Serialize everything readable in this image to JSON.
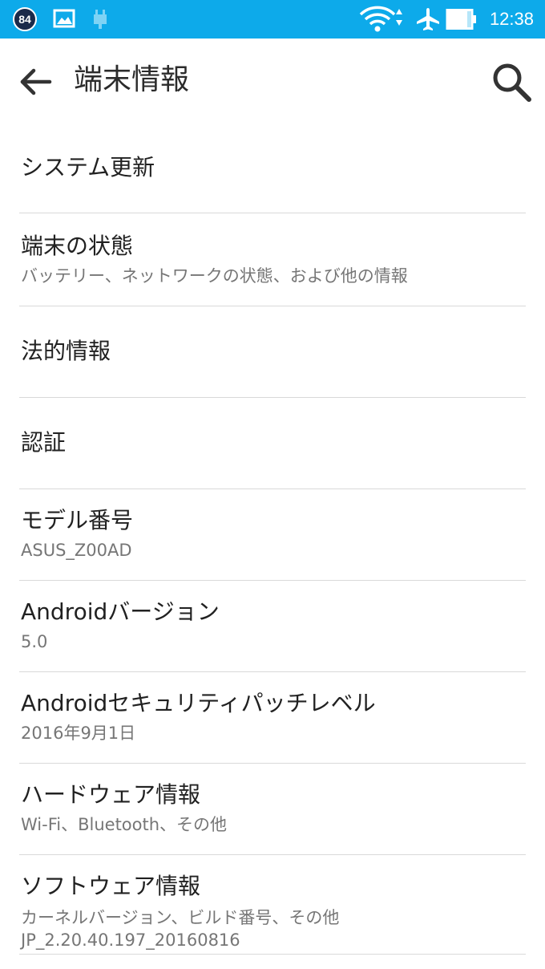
{
  "status_bar": {
    "badge_text": "84",
    "time": "12:38"
  },
  "app_bar": {
    "title": "端末情報"
  },
  "items": [
    {
      "title": "システム更新"
    },
    {
      "title": "端末の状態",
      "summary": "バッテリー、ネットワークの状態、および他の情報"
    },
    {
      "title": "法的情報"
    },
    {
      "title": "認証"
    },
    {
      "title": "モデル番号",
      "summary": "ASUS_Z00AD"
    },
    {
      "title": "Androidバージョン",
      "summary": "5.0"
    },
    {
      "title": "Androidセキュリティパッチレベル",
      "summary": "2016年9月1日"
    },
    {
      "title": "ハードウェア情報",
      "summary": "Wi-Fi、Bluetooth、その他"
    },
    {
      "title": "ソフトウェア情報",
      "summary": "カーネルバージョン、ビルド番号、その他",
      "summary2": "JP_2.20.40.197_20160816"
    }
  ],
  "icons": {
    "status": [
      "notification-badge",
      "gallery-icon",
      "usb-debug-icon",
      "wifi-icon",
      "airplane-icon",
      "battery-icon"
    ],
    "app_bar": [
      "back-arrow-icon",
      "search-icon"
    ]
  },
  "colors": {
    "status_bar": "#0daaea",
    "divider": "#d9d9d9",
    "summary_text": "#767676"
  }
}
